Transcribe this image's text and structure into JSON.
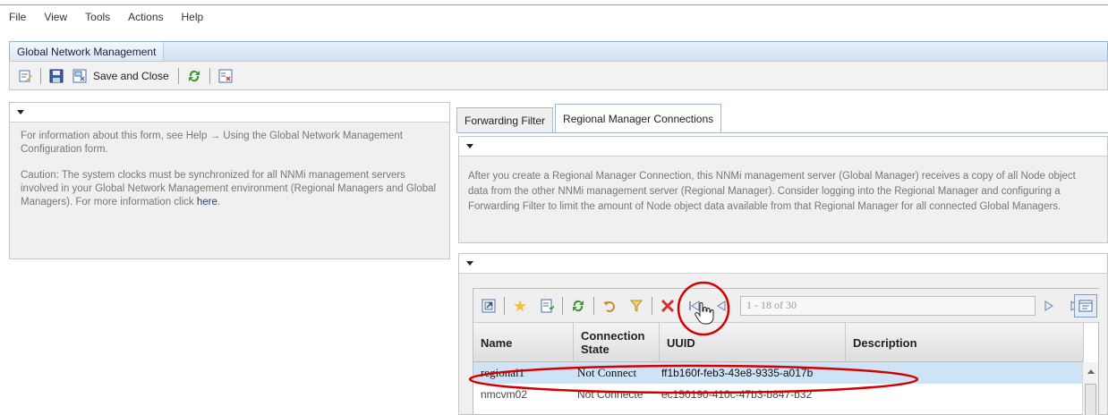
{
  "menu": [
    "File",
    "View",
    "Tools",
    "Actions",
    "Help"
  ],
  "window": {
    "title": "Global Network Management"
  },
  "toolbar": {
    "save_close_label": "Save and Close"
  },
  "left_panel": {
    "info": "For information about this form, see Help → Using the Global Network Management Configuration form.",
    "caution": "Caution: The system clocks must be synchronized for all NNMi management servers involved in your Global Network Management environment (Regional Managers and Global Managers). For more information click",
    "link": "here",
    "period": "."
  },
  "tabs": [
    {
      "label": "Forwarding Filter",
      "active": false
    },
    {
      "label": "Regional Manager Connections",
      "active": true
    }
  ],
  "connections_panel": {
    "info": "After you create a Regional Manager Connection, this NNMi management server (Global Manager) receives a copy of all Node object data from the other NNMi management server (Regional Manager). Consider logging into the Regional Manager and configuring a Forwarding Filter to limit the amount of Node object data available from that Regional Manager for all connected Global Managers."
  },
  "grid": {
    "pager_text": "1 - 18 of 30",
    "columns": [
      "Name",
      "Connection State",
      "UUID",
      "Description"
    ],
    "rows": [
      {
        "name": "regional1",
        "state": "Not Connect",
        "uuid": "ff1b160f-feb3-43e8-9335-a017b",
        "description": "",
        "selected": true
      },
      {
        "name": "nmcvm02",
        "state": "Not Connecte",
        "uuid": "ec150190-410c-47b3-b847-b32",
        "description": "",
        "selected": false
      }
    ]
  },
  "annotations": {
    "highlight_color": "#d40000"
  }
}
